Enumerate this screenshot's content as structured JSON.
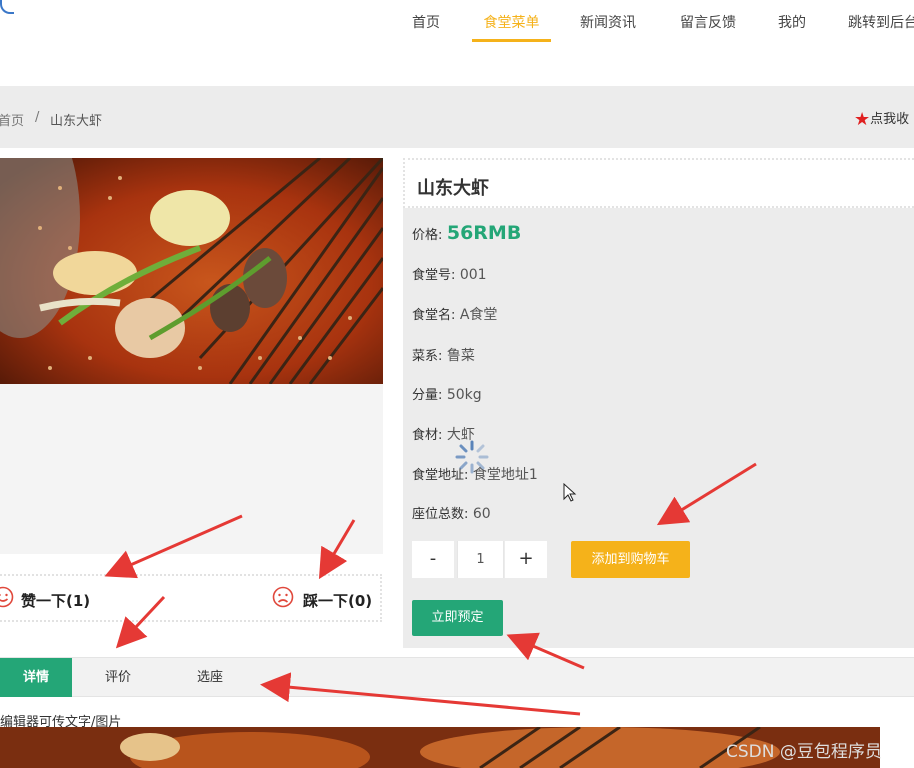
{
  "nav": {
    "items": [
      "首页",
      "食堂菜单",
      "新闻资讯",
      "留言反馈",
      "我的",
      "跳转到后台"
    ],
    "active_index": 1
  },
  "breadcrumb": {
    "home": "首页",
    "separator": "/",
    "current": "山东大虾"
  },
  "favorite": {
    "label": "点我收"
  },
  "dish": {
    "title": "山东大虾",
    "price_label": "价格:",
    "price_value": "56RMB",
    "fields": [
      {
        "label": "食堂号:",
        "value": "001"
      },
      {
        "label": "食堂名:",
        "value": "A食堂"
      },
      {
        "label": "菜系:",
        "value": "鲁菜"
      },
      {
        "label": "分量:",
        "value": "50kg"
      },
      {
        "label": "食材:",
        "value": "大虾"
      },
      {
        "label": "食堂地址:",
        "value": "食堂地址1"
      },
      {
        "label": "座位总数:",
        "value": "60"
      }
    ]
  },
  "quantity": {
    "minus": "-",
    "value": "1",
    "plus": "+"
  },
  "buttons": {
    "add_to_cart": "添加到购物车",
    "book_now": "立即预定"
  },
  "votes": {
    "like": "赞一下(1)",
    "dislike": "踩一下(0)"
  },
  "tabs": [
    "详情",
    "评价",
    "选座"
  ],
  "editor_note": "编辑器可传文字/图片",
  "watermark": "CSDN @豆包程序员",
  "colors": {
    "accent_yellow": "#f5b21a",
    "accent_green": "#24a677",
    "arrow_red": "#e53935",
    "star_red": "#e02020"
  },
  "icons": [
    "star-icon",
    "smile-icon",
    "frown-icon",
    "loading-spinner-icon",
    "mouse-cursor-icon",
    "annotation-arrow-icon"
  ]
}
